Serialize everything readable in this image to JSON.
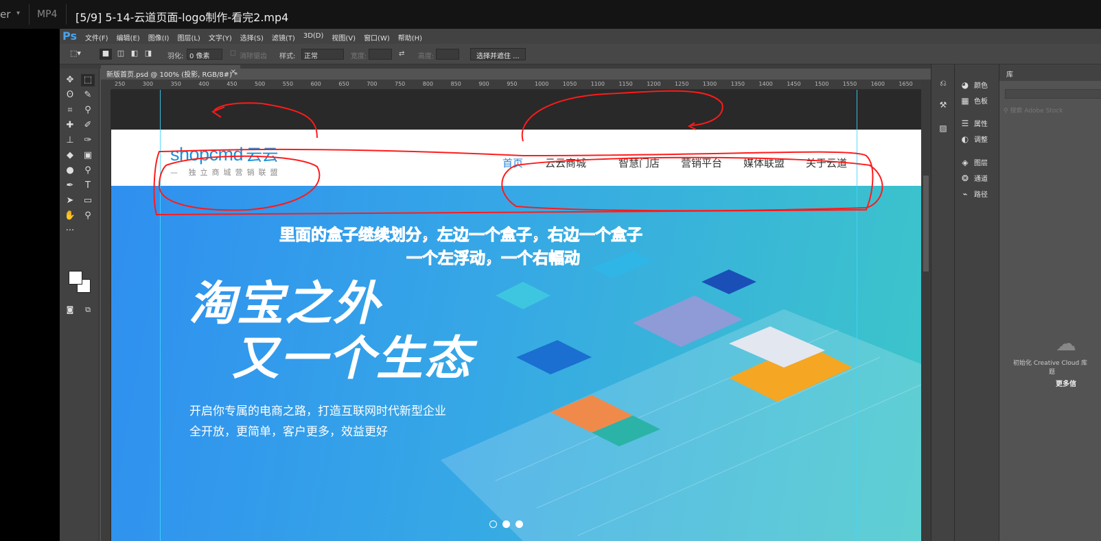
{
  "player": {
    "app_partial": "er",
    "format": "MP4",
    "title": "[5/9] 5-14-云道页面-logo制作-看完2.mp4"
  },
  "ps": {
    "logo": "Ps",
    "menu": [
      "文件(F)",
      "编辑(E)",
      "图像(I)",
      "图层(L)",
      "文字(Y)",
      "选择(S)",
      "滤镜(T)",
      "3D(D)",
      "视图(V)",
      "窗口(W)",
      "帮助(H)"
    ],
    "options": {
      "feather_label": "羽化:",
      "feather_value": "0 像素",
      "antialias_label": "消除锯齿",
      "style_label": "样式:",
      "style_value": "正常",
      "width_label": "宽度:",
      "height_label": "高度:",
      "select_mask_button": "选择并遮住 ..."
    },
    "doc_tab": "新版首页.psd @ 100% (投影, RGB/8#) *",
    "ruler_ticks": [
      "250",
      "300",
      "350",
      "400",
      "450",
      "500",
      "550",
      "600",
      "650",
      "700",
      "750",
      "800",
      "850",
      "900",
      "950",
      "1000",
      "1050",
      "1100",
      "1150",
      "1200",
      "1250",
      "1300",
      "1350",
      "1400",
      "1450",
      "1500",
      "1550",
      "1600",
      "1650"
    ],
    "panels": {
      "color": "颜色",
      "swatches": "色板",
      "properties": "属性",
      "adjustments": "调整",
      "layers": "图层",
      "channels": "通道",
      "paths": "路径",
      "library": "库",
      "stock_search": "搜索 Adobe Stock",
      "cc_init": "初始化 Creative Cloud 库",
      "cc_init_tail": "题",
      "more_info": "更多信"
    }
  },
  "site": {
    "logo_brand": "shopcmd",
    "logo_cn": "云云",
    "logo_tagline": "— 独立商城营销联盟",
    "nav": [
      "首页",
      "云云商城",
      "智慧门店",
      "营销平台",
      "媒体联盟",
      "关于云道"
    ],
    "hero_line1": "淘宝之外",
    "hero_line2": "又一个生态",
    "sub_line1": "开启你专属的电商之路，打造互联网时代新型企业",
    "sub_line2": "全开放，更简单，客户更多，效益更好"
  },
  "annotation": {
    "line1": "里面的盒子继续划分，左边一个盒子，右边一个盒子",
    "line2": "一个左浮动，一个右幅动"
  },
  "colors": {
    "annotation": "#ff1a1a",
    "brand_blue": "#1f8fd6",
    "nav_active": "#2a86d8"
  },
  "carousel": {
    "count": 3,
    "active_index": 1
  }
}
